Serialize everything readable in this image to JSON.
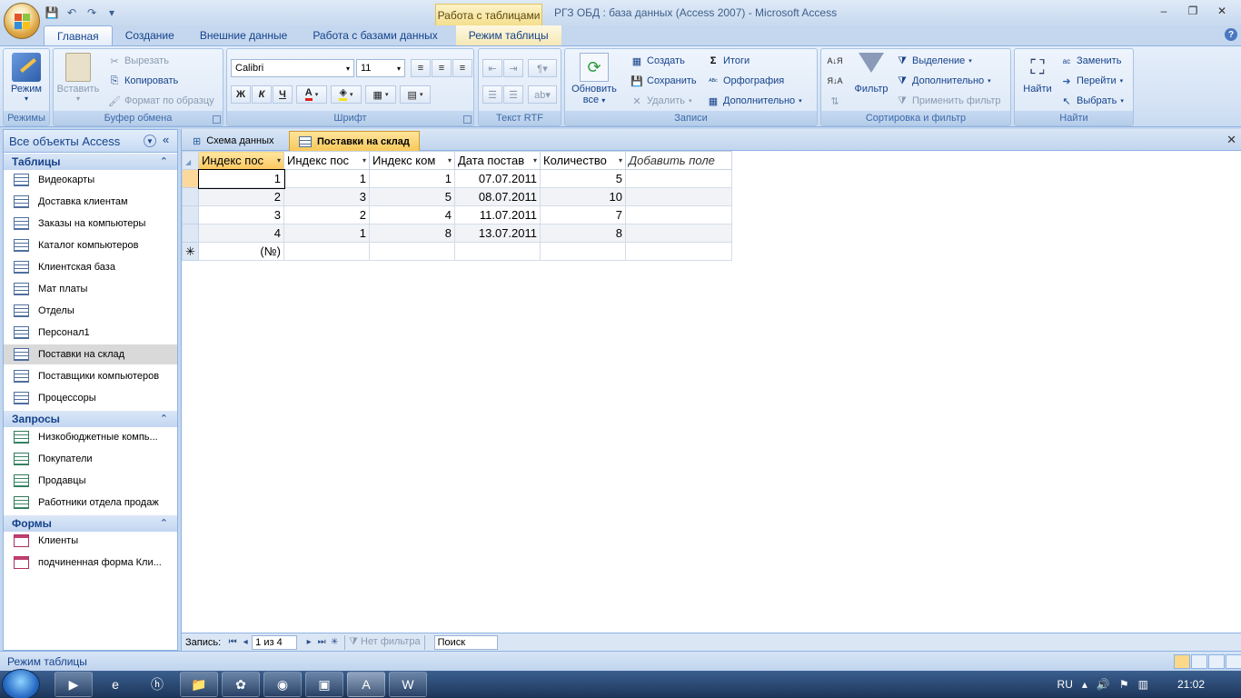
{
  "titlebar": {
    "context_tab": "Работа с таблицами",
    "window_title": "РГЗ ОБД : база данных (Access 2007) - Microsoft Access",
    "min": "‒",
    "max": "❐",
    "close": "✕"
  },
  "tabs": [
    "Главная",
    "Создание",
    "Внешние данные",
    "Работа с базами данных",
    "Режим таблицы"
  ],
  "ribbon": {
    "groups": {
      "modes": "Режимы",
      "clipboard": "Буфер обмена",
      "font": "Шрифт",
      "rtf": "Текст RTF",
      "records": "Записи",
      "sort": "Сортировка и фильтр",
      "find": "Найти"
    },
    "mode": "Режим",
    "paste": "Вставить",
    "cut": "Вырезать",
    "copy": "Копировать",
    "format_painter": "Формат по образцу",
    "font_name": "Calibri",
    "font_size": "11",
    "bold": "Ж",
    "italic": "К",
    "underline": "Ч",
    "refresh": "Обновить",
    "refresh2": "все",
    "create": "Создать",
    "save": "Сохранить",
    "delete": "Удалить",
    "totals": "Итоги",
    "spelling": "Орфография",
    "more": "Дополнительно",
    "filter": "Фильтр",
    "selection": "Выделение",
    "advanced": "Дополнительно",
    "apply_filter": "Применить фильтр",
    "find": "Найти",
    "replace": "Заменить",
    "goto": "Перейти",
    "select": "Выбрать"
  },
  "nav": {
    "header": "Все объекты Access",
    "tables_title": "Таблицы",
    "tables": [
      "Видеокарты",
      "Доставка клиентам",
      "Заказы на компьютеры",
      "Каталог компьютеров",
      "Клиентская база",
      "Мат платы",
      "Отделы",
      "Персонал1",
      "Поставки на склад",
      "Поставщики компьютеров",
      "Процессоры"
    ],
    "queries_title": "Запросы",
    "queries": [
      "Низкобюджетные компь...",
      "Покупатели",
      "Продавцы",
      "Работники отдела продаж"
    ],
    "forms_title": "Формы",
    "forms": [
      "Клиенты",
      "подчиненная форма Кли..."
    ]
  },
  "doc_tabs": [
    "Схема данных",
    "Поставки на склад"
  ],
  "grid": {
    "columns": [
      "Индекс пос",
      "Индекс пос",
      "Индекс ком",
      "Дата постав",
      "Количество",
      "Добавить поле"
    ],
    "rows": [
      [
        "1",
        "1",
        "1",
        "07.07.2011",
        "5"
      ],
      [
        "2",
        "3",
        "5",
        "08.07.2011",
        "10"
      ],
      [
        "3",
        "2",
        "4",
        "11.07.2011",
        "7"
      ],
      [
        "4",
        "1",
        "8",
        "13.07.2011",
        "8"
      ]
    ],
    "new_row_marker": "✳",
    "new_row_value": "(№)"
  },
  "recnav": {
    "label": "Запись:",
    "position": "1 из 4",
    "filter": "Нет фильтра",
    "search": "Поиск"
  },
  "status": "Режим таблицы",
  "tray": {
    "lang": "RU",
    "time": "21:02"
  }
}
